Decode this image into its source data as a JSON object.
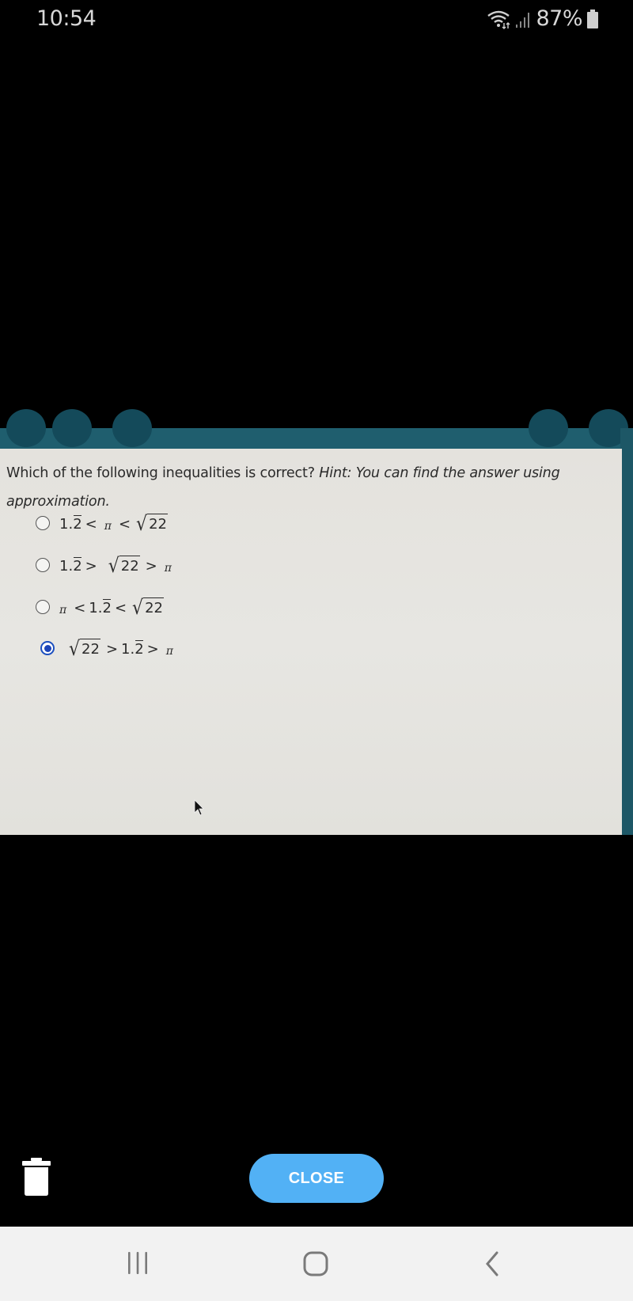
{
  "status_bar": {
    "time": "10:54",
    "battery_percent": "87%",
    "icons": [
      "wifi-icon",
      "signal-icon",
      "battery-icon"
    ]
  },
  "quiz": {
    "question": "Which of the following inequalities is correct?",
    "hint": "Hint: You can find the answer using approximation.",
    "options": [
      {
        "label": "1.2̅ < π < √22",
        "selected": false
      },
      {
        "label": "1.2̅ > √22 > π",
        "selected": false
      },
      {
        "label": "π < 1.2̅ < √22",
        "selected": false
      },
      {
        "label": "√22 > 1.2̅ > π",
        "selected": true
      }
    ],
    "parts": {
      "one": "1.",
      "two": "2",
      "lt": "<",
      "gt": ">",
      "pi": "π",
      "radical": "√",
      "radicand": "22"
    },
    "accent_color": "#1d45b8",
    "header_color": "#1f5e6e"
  },
  "bottom": {
    "close_label": "CLOSE",
    "close_color": "#52b1f5"
  },
  "nav": {
    "recents": "recents-icon",
    "home": "home-icon",
    "back": "back-icon"
  }
}
